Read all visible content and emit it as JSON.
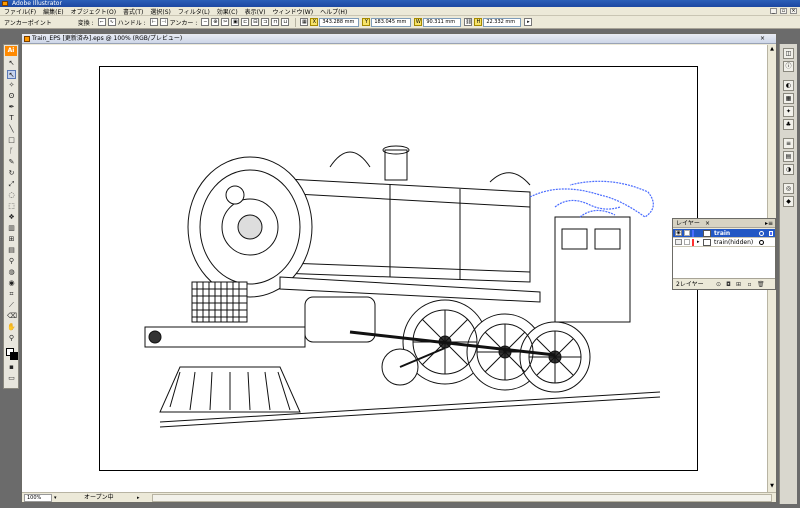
{
  "window": {
    "title": "Adobe Illustrator"
  },
  "menu": [
    "ファイル(F)",
    "編集(E)",
    "オブジェクト(O)",
    "書式(T)",
    "選択(S)",
    "フィルタ(L)",
    "効果(C)",
    "表示(V)",
    "ウィンドウ(W)",
    "ヘルプ(H)"
  ],
  "controlbar": {
    "tool_label": "アンカーポイント",
    "convert_label": "変換 :",
    "handle_label": "ハンドル :",
    "anchor_label": "アンカー :",
    "x_label": "X",
    "x_value": "343.288 mm",
    "y_label": "Y",
    "y_value": "183.045 mm",
    "w_label": "W",
    "w_value": "90.311 mm",
    "h_label": "H",
    "h_value": "22.332 mm"
  },
  "toolbar": {
    "logo": "Ai"
  },
  "document": {
    "tab_title": "Train_EPS [更新済み].eps @ 100% (RGB/プレビュー)",
    "zoom": "100%",
    "status": "オープン中"
  },
  "layers_panel": {
    "tab_label": "レイヤー",
    "close_glyph": "×",
    "footer_count": "2レイヤー",
    "layers": [
      {
        "name": "train",
        "color": "#4a6cff",
        "selected": true
      },
      {
        "name": "train(hidden)",
        "color": "#ff3030",
        "selected": false
      }
    ]
  },
  "colors": {
    "selection_blue": "#4a6cff",
    "accent": "#ff8a00"
  }
}
